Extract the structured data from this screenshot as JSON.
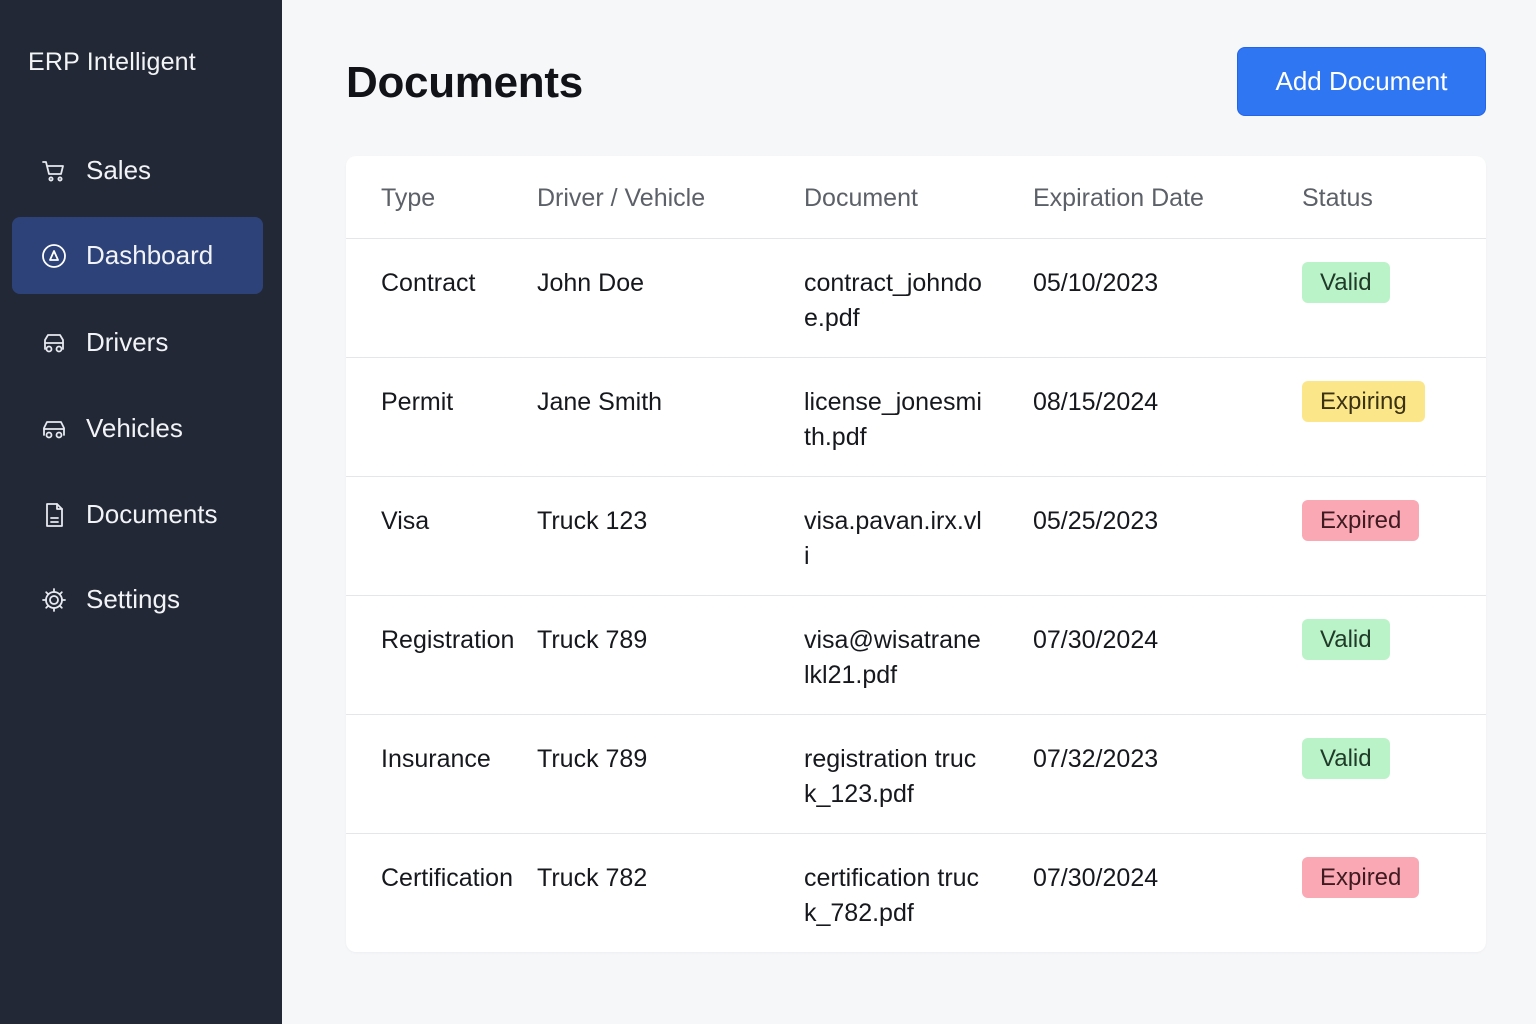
{
  "sidebar": {
    "brand": "ERP Intelligent",
    "items": [
      {
        "label": "Sales",
        "icon": "cart-icon",
        "active": false
      },
      {
        "label": "Dashboard",
        "icon": "dashboard-icon",
        "active": true
      },
      {
        "label": "Drivers",
        "icon": "car-icon",
        "active": false
      },
      {
        "label": "Vehicles",
        "icon": "vehicle-icon",
        "active": false
      },
      {
        "label": "Documents",
        "icon": "document-icon",
        "active": false
      },
      {
        "label": "Settings",
        "icon": "gear-icon",
        "active": false
      }
    ]
  },
  "header": {
    "title": "Documents",
    "add_button_label": "Add Document"
  },
  "table": {
    "columns": [
      "Type",
      "Driver / Vehicle",
      "Document",
      "Expiration Date",
      "Status"
    ],
    "rows": [
      {
        "type": "Contract",
        "driver": "John Doe",
        "document": "contract_johndoe.pdf",
        "expiration": "05/10/2023",
        "status": "Valid"
      },
      {
        "type": "Permit",
        "driver": "Jane Smith",
        "document": "license_jonesmith.pdf",
        "expiration": "08/15/2024",
        "status": "Expiring"
      },
      {
        "type": "Visa",
        "driver": "Truck 123",
        "document": "visa.pavan.irx.vli",
        "expiration": "05/25/2023",
        "status": "Expired"
      },
      {
        "type": "Registration",
        "driver": "Truck 789",
        "document": "visa@wisatranelkl21.pdf",
        "expiration": "07/30/2024",
        "status": "Valid"
      },
      {
        "type": "Insurance",
        "driver": "Truck 789",
        "document": "registration truck_123.pdf",
        "expiration": "07/32/2023",
        "status": "Valid"
      },
      {
        "type": "Certification",
        "driver": "Truck 782",
        "document": "certification truck_782.pdf",
        "expiration": "07/30/2024",
        "status": "Expired"
      }
    ]
  },
  "colors": {
    "sidebar_bg": "#222835",
    "active_item_bg": "#2d4278",
    "primary_button": "#2f76f3",
    "status": {
      "Valid": {
        "bg": "#bbf3c8",
        "fg": "#1f3a28"
      },
      "Expiring": {
        "bg": "#fbe78a",
        "fg": "#3b3212"
      },
      "Expired": {
        "bg": "#f9a8b4",
        "fg": "#3f1a20"
      }
    }
  }
}
